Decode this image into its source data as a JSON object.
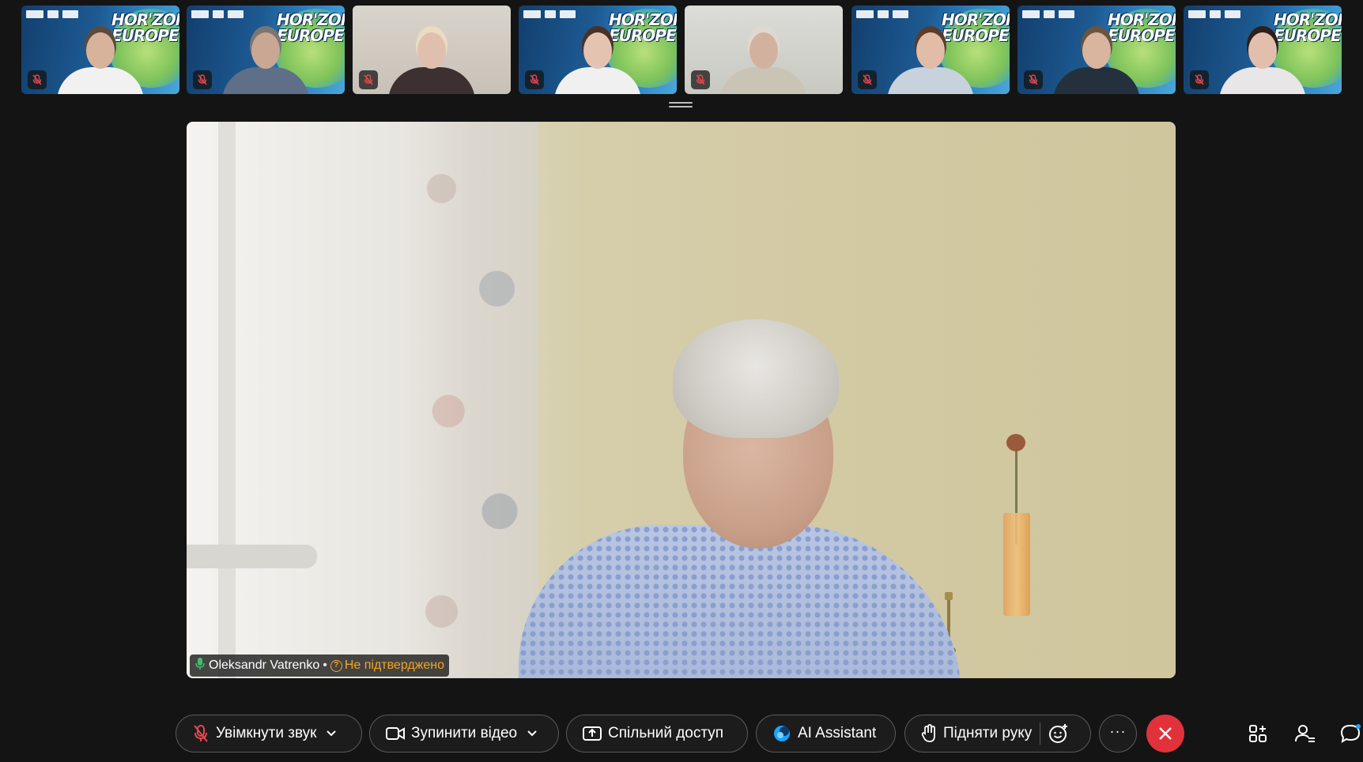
{
  "thumbnails": [
    {
      "id": "p1",
      "style": "horizon",
      "banner_text": "HOR'ZON EUROPE",
      "muted": true,
      "skin": "#d8b39c",
      "torso": "#f1f1f1",
      "hair": "#5b4a3e"
    },
    {
      "id": "p2",
      "style": "horizon",
      "banner_text": "HOR'ZON EUROPE",
      "muted": true,
      "skin": "#c9a793",
      "torso": "#5f6f88",
      "hair": "#7a7674"
    },
    {
      "id": "p3",
      "style": "room-a",
      "banner_text": "",
      "muted": true,
      "skin": "#e1bfae",
      "torso": "#3d3030",
      "hair": "#e9dcc3"
    },
    {
      "id": "p4",
      "style": "horizon",
      "banner_text": "HOR'ZON EUROPE",
      "muted": true,
      "skin": "#e4c3b0",
      "torso": "#f0f0f0",
      "hair": "#4a3128"
    },
    {
      "id": "p5",
      "style": "room-b",
      "banner_text": "",
      "muted": true,
      "skin": "#d3b19f",
      "torso": "#c9c4b6",
      "hair": "#ddd9d2"
    },
    {
      "id": "p6",
      "style": "horizon",
      "banner_text": "HOR'ZON EUROPE",
      "muted": true,
      "skin": "#e1bca6",
      "torso": "#c7d2dc",
      "hair": "#5a3b2c"
    },
    {
      "id": "p7",
      "style": "horizon",
      "banner_text": "HOR'ZON EUROPE",
      "muted": true,
      "skin": "#d9b49f",
      "torso": "#24313c",
      "hair": "#6a5440"
    },
    {
      "id": "p8",
      "style": "horizon",
      "banner_text": "HOR'ZON EUROPE",
      "muted": true,
      "skin": "#e2bfad",
      "torso": "#e9e6e8",
      "hair": "#2c201b"
    }
  ],
  "main_video": {
    "participant_name": "Oleksandr Vatrenko",
    "separator": "•",
    "status_text": "Не підтверджено",
    "status_icon": "?",
    "mic_active": true
  },
  "controls": {
    "unmute_label": "Увімкнути звук",
    "stop_video_label": "Зупинити відео",
    "share_label": "Спільний доступ",
    "ai_assistant_label": "AI Assistant",
    "raise_hand_label": "Підняти руку",
    "more_symbol": "···"
  },
  "colors": {
    "leave_red": "#e1323c",
    "mute_red": "#e5484d",
    "warning_orange": "#f4a524",
    "mic_green": "#3fbf6b",
    "ai_blue": "#1aa3ff"
  },
  "icons": {
    "unmute": "microphone-slash-icon",
    "video": "video-camera-icon",
    "share": "share-screen-icon",
    "ai": "ai-assistant-icon",
    "raise_hand": "hand-icon",
    "reactions": "emoji-plus-icon",
    "more": "more-icon",
    "leave": "close-icon",
    "apps": "apps-icon",
    "participants": "participants-icon",
    "chat": "chat-icon"
  }
}
